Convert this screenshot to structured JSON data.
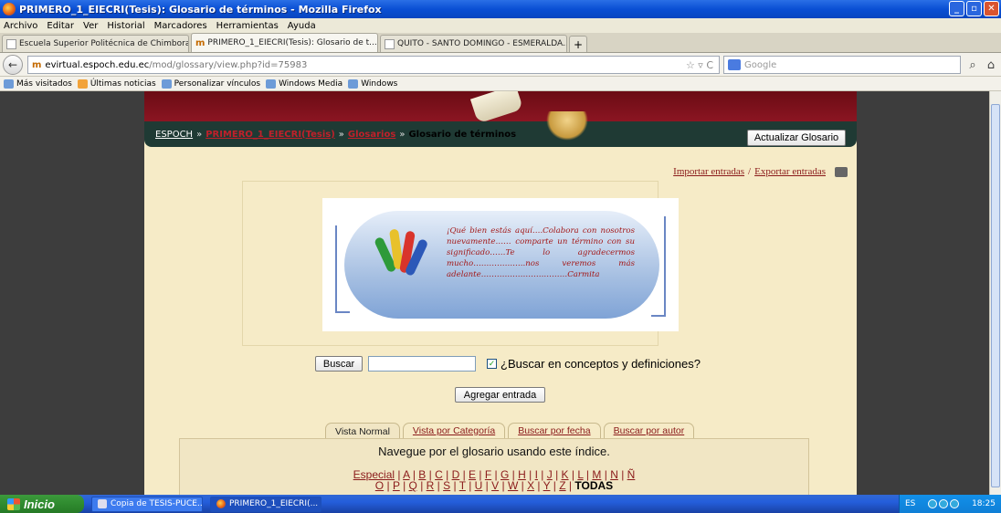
{
  "window": {
    "title": "PRIMERO_1_EIECRI(Tesis): Glosario de términos - Mozilla Firefox",
    "buttons": [
      "_",
      "▫",
      "✕"
    ]
  },
  "menu": [
    "Archivo",
    "Editar",
    "Ver",
    "Historial",
    "Marcadores",
    "Herramientas",
    "Ayuda"
  ],
  "tabs": [
    {
      "label": "Escuela Superior Politécnica de Chimborazo",
      "active": false
    },
    {
      "label": "PRIMERO_1_EIECRI(Tesis): Glosario de t...",
      "active": true
    },
    {
      "label": "QUITO - SANTO DOMINGO - ESMERALDA...",
      "active": false
    }
  ],
  "newtab_label": "+",
  "nav": {
    "back": "←",
    "site_badge": "m",
    "url_host": "evirtual.espoch.edu.ec",
    "url_path": "/mod/glossary/view.php?id=75983",
    "url_controls": "☆ ▿ C",
    "search_placeholder": "Google",
    "search_icon": "magnifier-icon",
    "home_icon": "home-icon"
  },
  "bookmarks": [
    "Más visitados",
    "Últimas noticias",
    "Personalizar vínculos",
    "Windows Media",
    "Windows"
  ],
  "page": {
    "breadcrumb": {
      "home": "ESPOCH",
      "sep": "»",
      "course": "PRIMERO_1_EIECRI(Tesis)",
      "section": "Glosarios",
      "current": "Glosario de términos"
    },
    "update_button": "Actualizar Glosario",
    "import_link": "Importar entradas",
    "export_sep": "/",
    "export_link": "Exportar entradas",
    "intro_quote": "¡Qué bien estás aquí….Colabora con nosotros nuevamente…… comparte un término con su significado……Te lo agradecermos mucho………………..nos veremos más adelante……………………………Carmita",
    "search_button": "Buscar",
    "search_value": "",
    "search_checkbox_label": "¿Buscar en conceptos y definiciones?",
    "search_checked": true,
    "check_mark": "✓",
    "add_button": "Agregar entrada",
    "view_tabs": [
      "Vista Normal",
      "Vista por Categoría",
      "Buscar por fecha",
      "Buscar por autor"
    ],
    "index_title": "Navegue por el glosario usando este índice.",
    "letters_row1": [
      "Especial",
      "A",
      "B",
      "C",
      "D",
      "E",
      "F",
      "G",
      "H",
      "I",
      "J",
      "K",
      "L",
      "M",
      "N",
      "Ñ"
    ],
    "letters_row2": [
      "O",
      "P",
      "Q",
      "R",
      "S",
      "T",
      "U",
      "V",
      "W",
      "X",
      "Y",
      "Z"
    ],
    "letters_all": "TODAS",
    "letter_sep": "|"
  },
  "taskbar": {
    "start": "Inicio",
    "tasks": [
      {
        "label": "Copia de TESIS-PUCE...",
        "active": false
      },
      {
        "label": "PRIMERO_1_EIECRI(...",
        "active": true
      }
    ],
    "lang": "ES",
    "clock": "18:25"
  }
}
